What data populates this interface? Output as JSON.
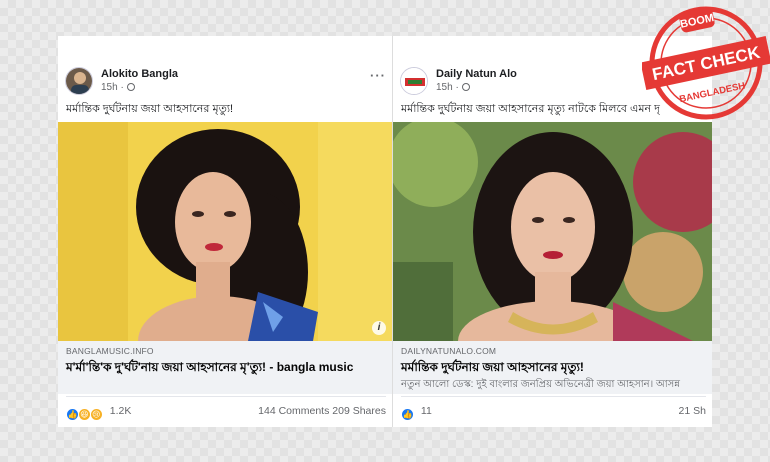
{
  "posts": [
    {
      "page_name": "Alokito Bangla",
      "time": "15h ·",
      "more": "···",
      "caption": "মর্মান্তিক দুর্ঘটনায় জয়া আহসানের মৃত্যু!",
      "link_domain": "BANGLAMUSIC.INFO",
      "link_title": "ম'র্মা'ন্তি'ক দু'র্ঘট'নায় জয়া আহসানের মৃ'ত্যু! - bangla music",
      "link_subtitle": "",
      "reaction_count": "1.2K",
      "comments": "144 Comments",
      "shares": "209 Shares",
      "info": "i",
      "reactions": [
        "like",
        "haha",
        "sad"
      ]
    },
    {
      "page_name": "Daily Natun Alo",
      "time": "15h ·",
      "caption": "মর্মান্তিক দুর্ঘটনায় জয়া আহসানের মৃত্যু নাটকে মিলবে এমন দৃ",
      "link_domain": "DAILYNATUNALO.COM",
      "link_title": "মর্মান্তিক দুর্ঘটনায় জয়া আহসানের মৃত্যু!",
      "link_subtitle": "নতুন আলো ডেস্ক: দুই বাংলার জনপ্রিয় অভিনেত্রী জয়া আহসান। আসন্ন",
      "reaction_count": "11",
      "comments": "",
      "shares": "21 Sh",
      "reactions": [
        "like"
      ]
    }
  ],
  "stamp": {
    "brand": "BOOM",
    "label": "FACT CHECK",
    "region": "BANGLADESH",
    "color": "#e53935"
  },
  "colors": {
    "like_blue": "#1877f2",
    "haha_yellow": "#f7b125",
    "link_bg": "#f0f2f5"
  }
}
